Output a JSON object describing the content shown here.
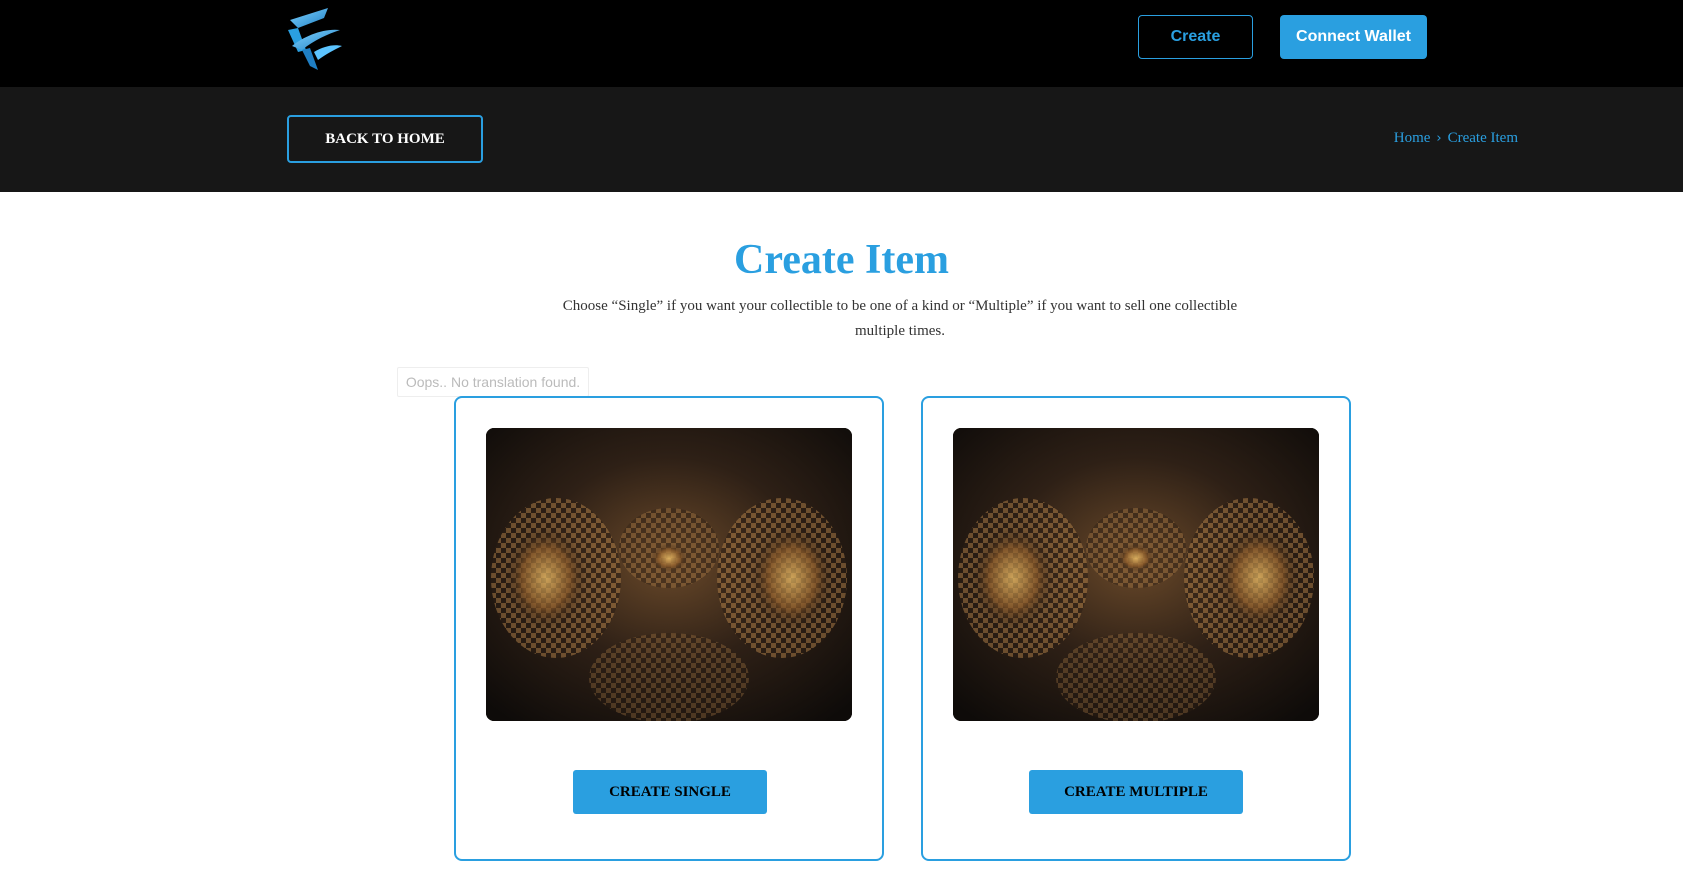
{
  "header": {
    "create_label": "Create",
    "connect_wallet_label": "Connect Wallet"
  },
  "subheader": {
    "back_label": "BACK TO HOME",
    "breadcrumb": {
      "home": "Home",
      "current": "Create Item"
    }
  },
  "main": {
    "title": "Create Item",
    "description": "Choose “Single” if you want your collectible to be one of a kind or “Multiple” if you want to sell one collectible multiple times.",
    "tooltip": "Oops.. No translation found.",
    "cards": [
      {
        "button_label": "CREATE SINGLE"
      },
      {
        "button_label": "CREATE MULTIPLE"
      }
    ]
  },
  "colors": {
    "accent": "#2a9fe0",
    "topbar": "#000000",
    "subbar": "#171717"
  },
  "icons": {
    "logo": "brand-logo-icon",
    "breadcrumb_separator": "chevron-right-icon"
  }
}
